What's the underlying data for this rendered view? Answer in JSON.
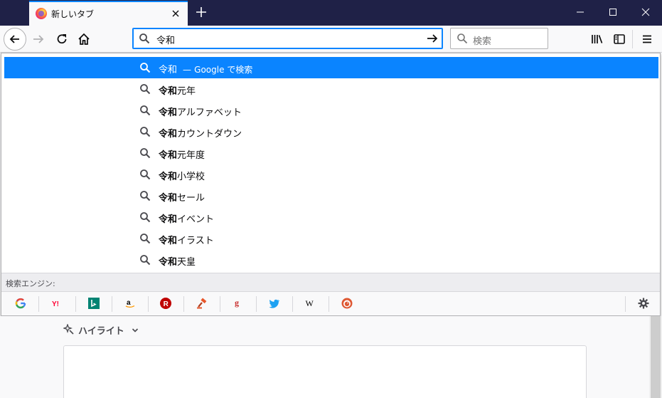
{
  "window": {
    "tab_title": "新しいタブ"
  },
  "urlbar": {
    "value": "令和"
  },
  "searchbar": {
    "placeholder": "検索"
  },
  "suggestions": {
    "first": {
      "query": "令和",
      "separator": "—",
      "engine_text": "Google で検索"
    },
    "items": [
      {
        "bold": "令和",
        "rest": "元年"
      },
      {
        "bold": "令和",
        "rest": "アルファベット"
      },
      {
        "bold": "令和",
        "rest": "カウントダウン"
      },
      {
        "bold": "令和",
        "rest": "元年度"
      },
      {
        "bold": "令和",
        "rest": "小学校"
      },
      {
        "bold": "令和",
        "rest": "セール"
      },
      {
        "bold": "令和",
        "rest": "イベント"
      },
      {
        "bold": "令和",
        "rest": "イラスト"
      },
      {
        "bold": "令和",
        "rest": "天皇"
      }
    ]
  },
  "engines": {
    "label": "検索エンジン:",
    "items": [
      "google-icon",
      "yahoo-icon",
      "bing-icon",
      "amazon-icon",
      "rakuten-icon",
      "auction-icon",
      "goo-icon",
      "twitter-icon",
      "wikipedia-icon",
      "duckduckgo-icon"
    ]
  },
  "page": {
    "highlights_label": "ハイライト"
  },
  "colors": {
    "accent": "#0a84ff",
    "titlebar": "#1f2147"
  }
}
